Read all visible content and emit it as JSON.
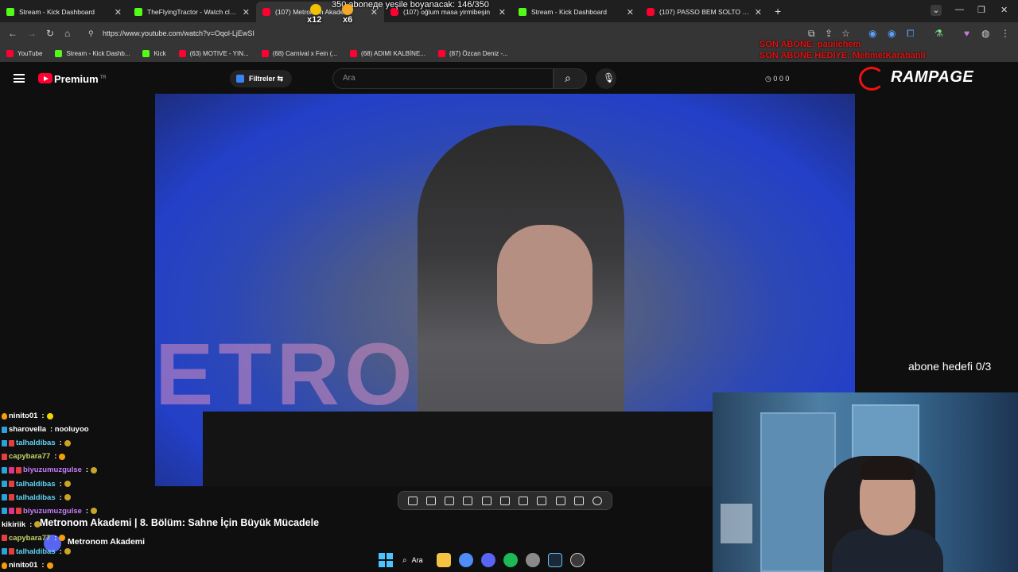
{
  "browser": {
    "tabs": [
      {
        "title": "Stream - Kick Dashboard",
        "icon": "kick-icon",
        "active": false
      },
      {
        "title": "TheFlyingTractor - Watch clips",
        "icon": "kick-icon",
        "active": false
      },
      {
        "title": "(107) Metronom Akademi",
        "icon": "youtube-icon",
        "active": true
      },
      {
        "title": "(107) oğlum masa yirmibeşin",
        "icon": "youtube-icon",
        "active": false
      },
      {
        "title": "Stream - Kick Dashboard",
        "icon": "kick-icon",
        "active": false
      },
      {
        "title": "(107) PASSO BEM SOLTO (ULTR",
        "icon": "youtube-icon",
        "active": false
      }
    ],
    "url": "https://www.youtube.com/watch?v=Oqol-LjEwSI",
    "bookmarks": [
      {
        "label": "YouTube",
        "icon": "youtube-icon"
      },
      {
        "label": "Stream - Kick Dashb...",
        "icon": "kick-icon"
      },
      {
        "label": "Kick",
        "icon": "kick-icon"
      },
      {
        "label": "(63) MOTIVE - YIN...",
        "icon": "youtube-icon"
      },
      {
        "label": "(68) Carnival x Fein (...",
        "icon": "youtube-icon"
      },
      {
        "label": "(68) ADIMI KALBİNE...",
        "icon": "youtube-icon"
      },
      {
        "label": "(87) Özcan Deniz -...",
        "icon": "youtube-icon"
      }
    ]
  },
  "youtube": {
    "premium_label": "Premium",
    "premium_sup": "TR",
    "filter_label": "Filtreler",
    "search_placeholder": "Ara",
    "stats": "0  0  0",
    "video_title": "Metronom Akademi | 8. Bölüm: Sahne İçin Büyük Mücadele",
    "channel_name": "Metronom Akademi"
  },
  "overlay": {
    "goal_text": "350 aboneде yeşile boyanacak: 146/350",
    "combo1": "x12",
    "combo2": "x6",
    "last_sub": "SON ABONE: pauiichem",
    "last_gift": "SON ABONE HEDİYE: MehmetKarahanli",
    "sub_goal": "abone hedefi 0/3",
    "rampage_text": "RAMPAGE"
  },
  "chat": [
    {
      "user": "ninito01",
      "color": "#ffffff",
      "badges": [
        "fire"
      ],
      "text": ":",
      "emote": "#f2d500"
    },
    {
      "user": "sharovella",
      "color": "#ffffff",
      "badges": [
        "blue"
      ],
      "text": ": nooluyoo",
      "emote": ""
    },
    {
      "user": "talhaldibas",
      "color": "#5fd3f3",
      "badges": [
        "blue",
        "red"
      ],
      "text": ":",
      "emote": "#c9a32a"
    },
    {
      "user": "capybara77",
      "color": "#c7d46a",
      "badges": [
        "red"
      ],
      "text": ":",
      "emote": "#f59e0b"
    },
    {
      "user": "biyuzumuzgulse",
      "color": "#c77dff",
      "badges": [
        "blue",
        "pink",
        "red"
      ],
      "text": ":",
      "emote": "#c9a32a"
    },
    {
      "user": "talhaldibas",
      "color": "#5fd3f3",
      "badges": [
        "blue",
        "red"
      ],
      "text": ":",
      "emote": "#c9a32a"
    },
    {
      "user": "talhaldibas",
      "color": "#5fd3f3",
      "badges": [
        "blue",
        "red"
      ],
      "text": ":",
      "emote": "#c9a32a"
    },
    {
      "user": "biyuzumuzgulse",
      "color": "#c77dff",
      "badges": [
        "blue",
        "pink",
        "red"
      ],
      "text": ":",
      "emote": "#c9a32a"
    },
    {
      "user": "kikiriik",
      "color": "#ffffff",
      "badges": [],
      "text": ":",
      "emote": "#c9a32a"
    },
    {
      "user": "capybara77",
      "color": "#c7d46a",
      "badges": [
        "red"
      ],
      "text": ":",
      "emote": "#f59e0b"
    },
    {
      "user": "talhaldibas",
      "color": "#5fd3f3",
      "badges": [
        "blue",
        "red"
      ],
      "text": ":",
      "emote": "#c9a32a"
    },
    {
      "user": "ninito01",
      "color": "#ffffff",
      "badges": [
        "fire"
      ],
      "text": ":",
      "emote": "#f59e0b"
    }
  ],
  "taskbar": {
    "search_label": "Ara",
    "apps": [
      "file-explorer-icon",
      "chrome-icon",
      "discord-icon",
      "spotify-icon",
      "settings-icon",
      "steam-icon",
      "obs-icon"
    ]
  },
  "colors": {
    "kick": "#53fc18",
    "youtube": "#ff0033",
    "accent_red": "#e01010"
  }
}
